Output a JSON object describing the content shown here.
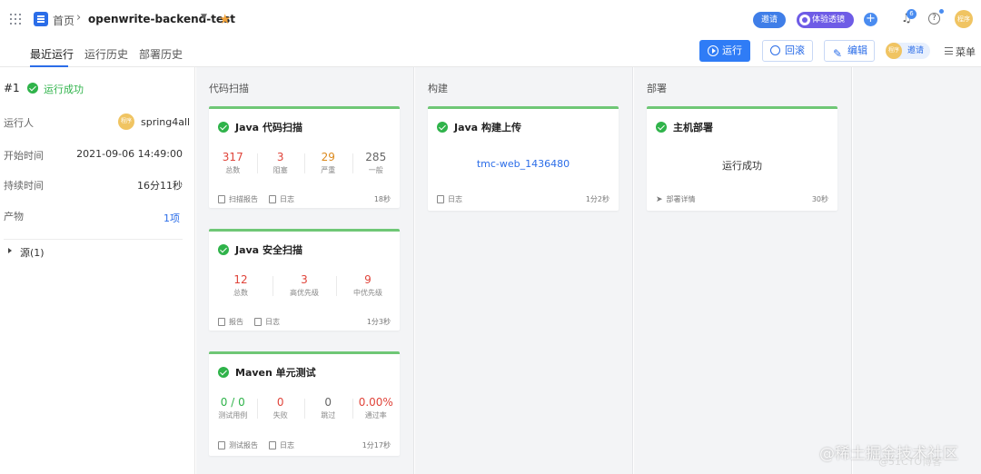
{
  "topbar": {
    "home": "首页",
    "separator": "›",
    "project": "openwrite-backend-test",
    "invite_label": "邀请",
    "trial_label": "体验透镜",
    "notification_count": "6",
    "avatar_text": "程序"
  },
  "tabs": [
    {
      "label": "最近运行",
      "active": true
    },
    {
      "label": "运行历史",
      "active": false
    },
    {
      "label": "部署历史",
      "active": false
    }
  ],
  "actions": {
    "run": "运行",
    "rollback": "回滚",
    "edit": "编辑",
    "invite": "邀请",
    "invite_avatar": "程序",
    "menu": "菜单"
  },
  "run_info": {
    "number": "#1",
    "status": "运行成功",
    "runner_label": "运行人",
    "runner_avatar": "程序",
    "runner": "spring4all",
    "start_label": "开始时间",
    "start_time": "2021-09-06 14:49:00",
    "duration_label": "持续时间",
    "duration": "16分11秒",
    "artifact_label": "产物",
    "artifact_value": "1项",
    "source_label": "源(1)"
  },
  "stages": [
    {
      "title": "代码扫描",
      "cards": [
        {
          "title": "Java 代码扫描",
          "metrics": [
            {
              "value": "317",
              "label": "总数",
              "color": "#e0443a"
            },
            {
              "value": "3",
              "label": "阻塞",
              "color": "#e0443a"
            },
            {
              "value": "29",
              "label": "严重",
              "color": "#dc8a1e"
            },
            {
              "value": "285",
              "label": "一般",
              "color": "#666666"
            }
          ],
          "links": [
            "扫描报告",
            "日志"
          ],
          "time": "18秒"
        },
        {
          "title": "Java 安全扫描",
          "metrics": [
            {
              "value": "12",
              "label": "总数",
              "color": "#e0443a"
            },
            {
              "value": "3",
              "label": "高优先级",
              "color": "#e0443a"
            },
            {
              "value": "9",
              "label": "中优先级",
              "color": "#e0443a"
            }
          ],
          "links": [
            "报告",
            "日志"
          ],
          "time": "1分3秒"
        },
        {
          "title": "Maven 单元测试",
          "metrics": [
            {
              "value": "0 / 0",
              "label": "测试用例",
              "color": "#2fb34a"
            },
            {
              "value": "0",
              "label": "失败",
              "color": "#e0443a"
            },
            {
              "value": "0",
              "label": "跳过",
              "color": "#666666"
            },
            {
              "value": "0.00%",
              "label": "通过率",
              "color": "#e0443a"
            }
          ],
          "links": [
            "测试报告",
            "日志"
          ],
          "time": "1分17秒"
        }
      ]
    },
    {
      "title": "构建",
      "cards": [
        {
          "title": "Java 构建上传",
          "artifact": "tmc-web_1436480",
          "links": [
            "日志"
          ],
          "time": "1分2秒"
        }
      ]
    },
    {
      "title": "部署",
      "cards": [
        {
          "title": "主机部署",
          "result": "运行成功",
          "links": [
            "部署详情"
          ],
          "time": "30秒"
        }
      ]
    }
  ],
  "watermark": {
    "main": "@稀土掘金技术社区",
    "sub": "@51CTO博客"
  }
}
